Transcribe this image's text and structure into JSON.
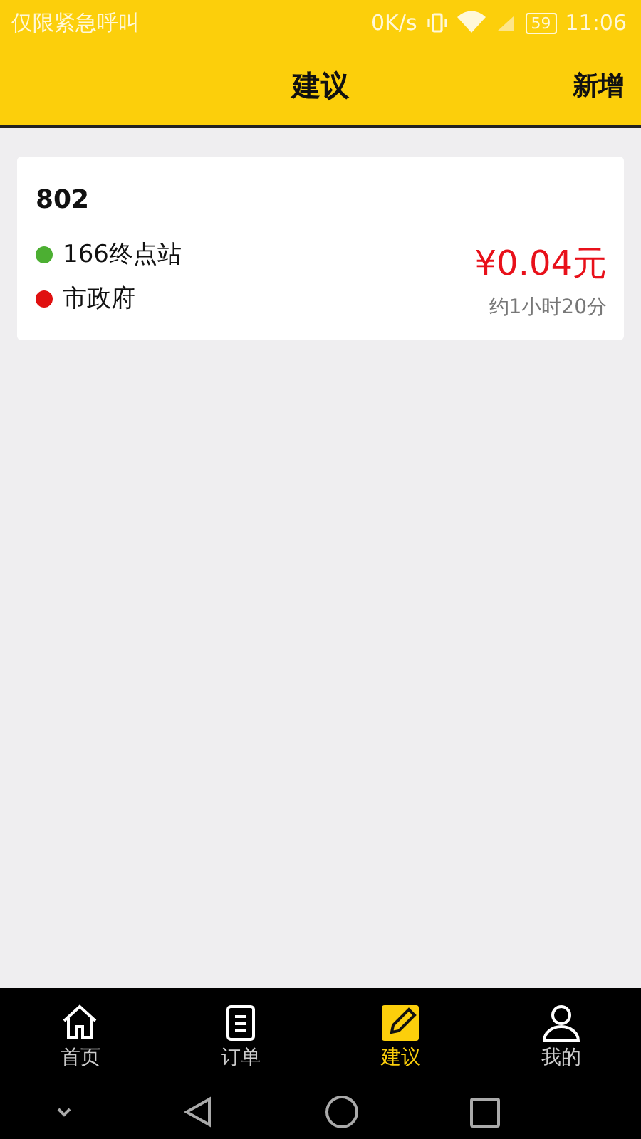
{
  "status_bar": {
    "carrier": "仅限紧急呼叫",
    "speed": "0K/s",
    "battery": "59",
    "time": "11:06"
  },
  "header": {
    "title": "建议",
    "action": "新增"
  },
  "cards": [
    {
      "route": "802",
      "price": "¥0.04元",
      "duration": "约1小时20分",
      "stops": [
        {
          "name": "166终点站",
          "color": "#4caf32"
        },
        {
          "name": "市政府",
          "color": "#e01010"
        }
      ]
    }
  ],
  "tabs": [
    {
      "kind": "home",
      "label": "首页",
      "selected": false
    },
    {
      "kind": "orders",
      "label": "订单",
      "selected": false
    },
    {
      "kind": "edit",
      "label": "建议",
      "selected": true
    },
    {
      "kind": "profile",
      "label": "我的",
      "selected": false
    }
  ]
}
